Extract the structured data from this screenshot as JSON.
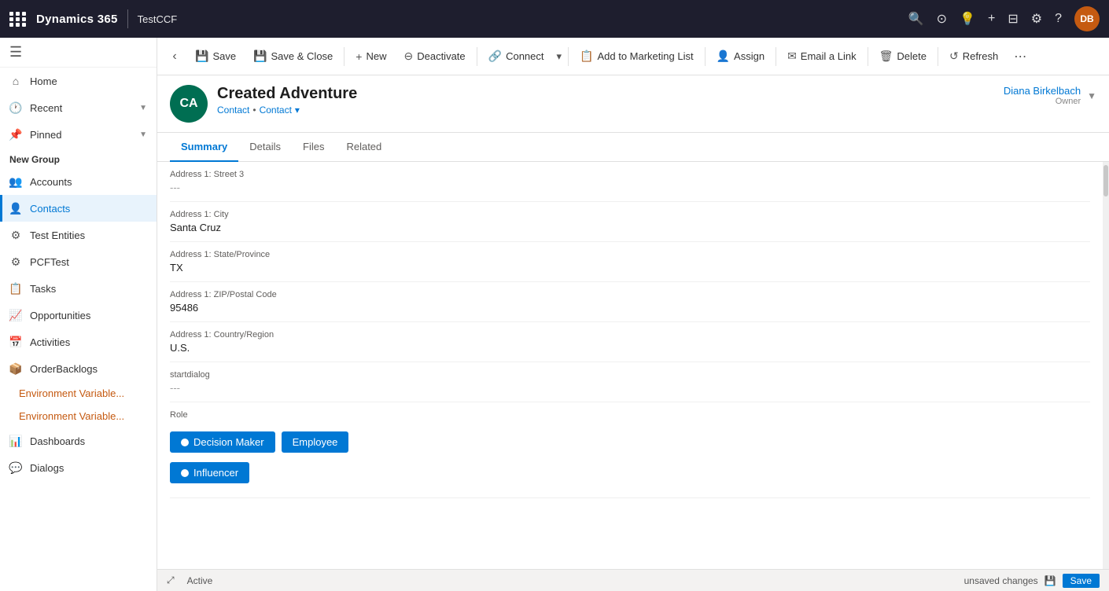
{
  "topNav": {
    "brand": "Dynamics 365",
    "org": "TestCCF",
    "avatar": "DB"
  },
  "sidebar": {
    "navItems": [
      {
        "id": "home",
        "label": "Home",
        "icon": "⌂"
      },
      {
        "id": "recent",
        "label": "Recent",
        "icon": "🕐",
        "hasChevron": true
      },
      {
        "id": "pinned",
        "label": "Pinned",
        "icon": "📌",
        "hasChevron": true
      }
    ],
    "groupLabel": "New Group",
    "groupItems": [
      {
        "id": "accounts",
        "label": "Accounts",
        "icon": "👥"
      },
      {
        "id": "contacts",
        "label": "Contacts",
        "icon": "👤",
        "active": true
      },
      {
        "id": "test-entities",
        "label": "Test Entities",
        "icon": "⚙"
      },
      {
        "id": "pcftest",
        "label": "PCFTest",
        "icon": "⚙"
      },
      {
        "id": "tasks",
        "label": "Tasks",
        "icon": "📋"
      },
      {
        "id": "opportunities",
        "label": "Opportunities",
        "icon": "📈"
      },
      {
        "id": "activities",
        "label": "Activities",
        "icon": "📅"
      },
      {
        "id": "orderbacklogs",
        "label": "OrderBacklogs",
        "icon": "📦"
      }
    ],
    "textItems": [
      {
        "id": "env-var-1",
        "label": "Environment Variable..."
      },
      {
        "id": "env-var-2",
        "label": "Environment Variable..."
      }
    ],
    "bottomItems": [
      {
        "id": "dashboards",
        "label": "Dashboards",
        "icon": "📊"
      },
      {
        "id": "dialogs",
        "label": "Dialogs",
        "icon": "💬"
      }
    ]
  },
  "commandBar": {
    "buttons": [
      {
        "id": "save",
        "label": "Save",
        "icon": "💾"
      },
      {
        "id": "save-close",
        "label": "Save & Close",
        "icon": "💾"
      },
      {
        "id": "new",
        "label": "New",
        "icon": "+"
      },
      {
        "id": "deactivate",
        "label": "Deactivate",
        "icon": "🚫"
      },
      {
        "id": "connect",
        "label": "Connect",
        "icon": "🔗"
      },
      {
        "id": "add-to-marketing",
        "label": "Add to Marketing List",
        "icon": "📋"
      },
      {
        "id": "assign",
        "label": "Assign",
        "icon": "👤"
      },
      {
        "id": "email-link",
        "label": "Email a Link",
        "icon": "✉"
      },
      {
        "id": "delete",
        "label": "Delete",
        "icon": "🗑"
      },
      {
        "id": "refresh",
        "label": "Refresh",
        "icon": "↺"
      }
    ]
  },
  "record": {
    "initials": "CA",
    "title": "Created Adventure",
    "subtitle1": "Contact",
    "subtitle2": "Contact",
    "ownerName": "Diana Birkelbach",
    "ownerLabel": "Owner"
  },
  "tabs": [
    {
      "id": "summary",
      "label": "Summary",
      "active": true
    },
    {
      "id": "details",
      "label": "Details"
    },
    {
      "id": "files",
      "label": "Files"
    },
    {
      "id": "related",
      "label": "Related"
    }
  ],
  "formFields": [
    {
      "id": "address1-street3",
      "label": "Address 1: Street 3",
      "value": "---",
      "isEmpty": true
    },
    {
      "id": "address1-city",
      "label": "Address 1: City",
      "value": "Santa Cruz",
      "isEmpty": false
    },
    {
      "id": "address1-state",
      "label": "Address 1: State/Province",
      "value": "TX",
      "isEmpty": false
    },
    {
      "id": "address1-zip",
      "label": "Address 1: ZIP/Postal Code",
      "value": "95486",
      "isEmpty": false
    },
    {
      "id": "address1-country",
      "label": "Address 1: Country/Region",
      "value": "U.S.",
      "isEmpty": false
    },
    {
      "id": "startdialog",
      "label": "startdialog",
      "value": "---",
      "isEmpty": true
    }
  ],
  "roleSection": {
    "label": "Role",
    "buttons": [
      {
        "id": "decision-maker",
        "label": "Decision Maker",
        "active": true
      },
      {
        "id": "employee",
        "label": "Employee",
        "active": false
      },
      {
        "id": "influencer",
        "label": "Influencer",
        "active": true
      }
    ]
  },
  "statusBar": {
    "expandIcon": "⤢",
    "status": "Active",
    "unsavedText": "unsaved changes",
    "saveLabel": "Save"
  }
}
